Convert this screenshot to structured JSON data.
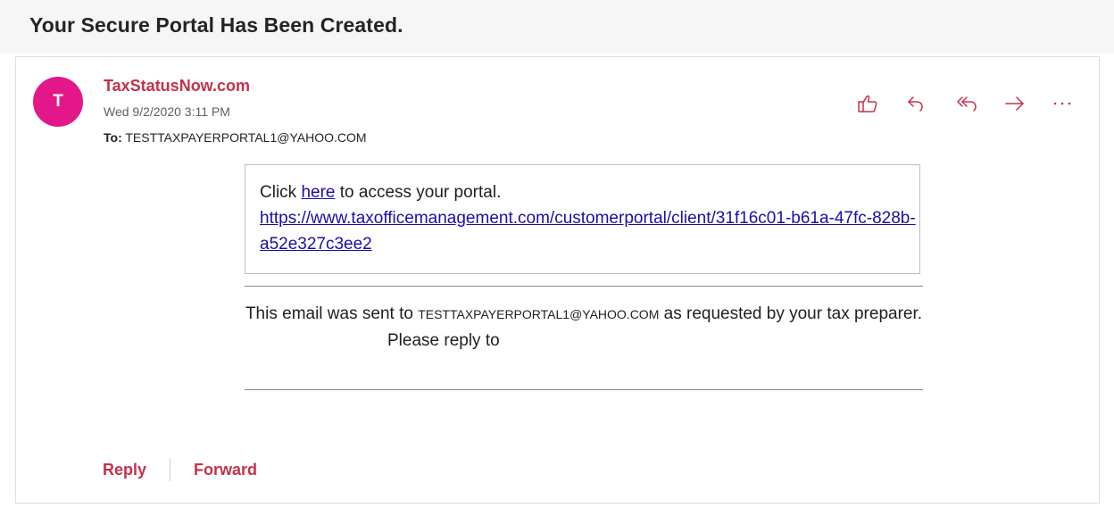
{
  "subject": "Your Secure Portal Has Been Created.",
  "message": {
    "avatar_initial": "T",
    "sender": "TaxStatusNow.com",
    "date": "Wed 9/2/2020 3:11 PM",
    "to_label": "To:",
    "to_address": "TESTTAXPAYERPORTAL1@YAHOO.COM",
    "actions": [
      {
        "icon": "like-icon"
      },
      {
        "icon": "reply-icon"
      },
      {
        "icon": "reply-all-icon"
      },
      {
        "icon": "forward-icon"
      },
      {
        "icon": "more-icon"
      }
    ]
  },
  "body": {
    "click_prefix": "Click",
    "here_link": "here",
    "click_suffix": "to access your portal.",
    "portal_url": "https://www.taxofficemanagement.com/customerportal/client/31f16c01-b61a-47fc-828b-a52e327c3ee2",
    "notice_prefix": "This email was sent to",
    "notice_email": "TESTTAXPAYERPORTAL1@YAHOO.COM",
    "notice_suffix": "as requested by your tax preparer.",
    "reply_to": "Please reply to"
  },
  "footer": {
    "reply_label": "Reply",
    "forward_label": "Forward"
  },
  "colors": {
    "accent": "#c4314b",
    "avatar": "#e3178a",
    "link": "#1a0dab"
  }
}
